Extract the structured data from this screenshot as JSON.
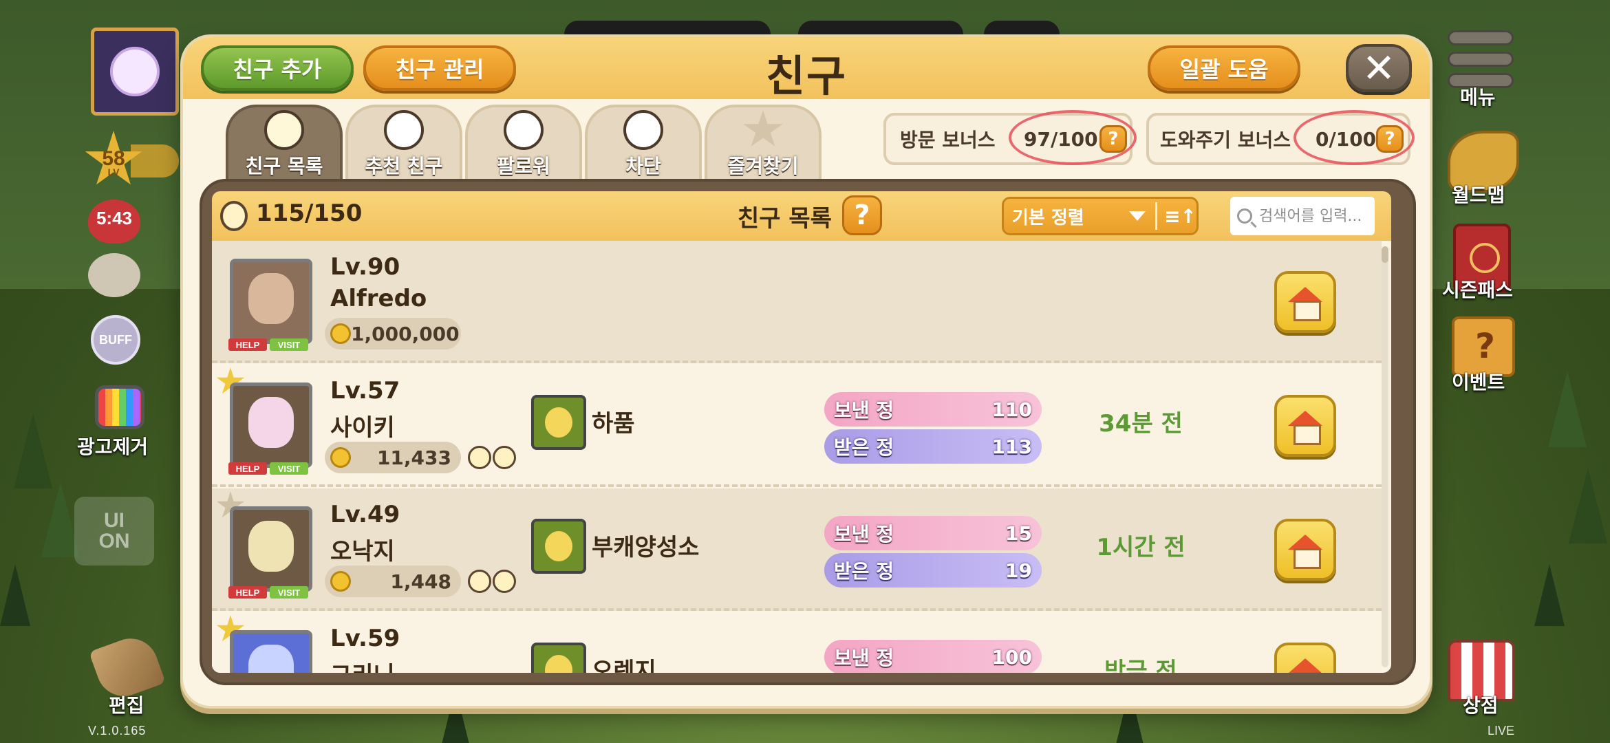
{
  "colors": {
    "panel_bg": "#fbf4e2",
    "header_gold": "#f2c15c",
    "green_button": "#5e9a2b",
    "orange_button": "#e58f1d",
    "last_seen_green": "#5c9a36",
    "sent_pink": "#f4a6c4",
    "received_purple": "#a99ce6"
  },
  "hud_left": {
    "level": "58",
    "level_unit": "LV",
    "timer": "5:43",
    "buff_label": "BUFF",
    "ad_remove_label": "광고제거",
    "ui_toggle_label": "UI\nON",
    "edit_label": "편집",
    "version": "V.1.0.165"
  },
  "hud_right": {
    "menu_label": "메뉴",
    "worldmap_label": "월드맵",
    "seasonpass_label": "시즌패스",
    "event_label": "이벤트",
    "shop_label": "상점",
    "live_label": "LIVE"
  },
  "panel": {
    "title": "친구",
    "add_friend": "친구 추가",
    "manage_friend": "친구 관리",
    "bulk_help": "일괄 도움",
    "close_icon": "✕"
  },
  "tabs": [
    {
      "label": "친구 목록",
      "icon": "friend-face-icon",
      "active": true
    },
    {
      "label": "추천 친구",
      "icon": "recommend-face-icon",
      "active": false
    },
    {
      "label": "팔로워",
      "icon": "follower-face-icon",
      "active": false
    },
    {
      "label": "차단",
      "icon": "block-face-icon",
      "active": false
    },
    {
      "label": "즐겨찾기",
      "icon": "star-icon",
      "active": false
    }
  ],
  "bonuses": {
    "visit": {
      "label": "방문 보너스",
      "value": "97/100",
      "help": "?"
    },
    "help": {
      "label": "도와주기 보너스",
      "value": "0/100",
      "help": "?"
    }
  },
  "list": {
    "count": "115/150",
    "title": "친구 목록",
    "help": "?",
    "sort_label": "기본 정렬",
    "sort_toggle": "≡↑",
    "search_placeholder": "검색어를 입력..."
  },
  "tags": {
    "help": "HELP",
    "visit": "VISIT"
  },
  "friends": [
    {
      "level": "Lv.90",
      "name": "Alfredo",
      "coins": "1,000,000",
      "favorite": false,
      "mutual": false,
      "village": "",
      "sent_label": "",
      "sent": "",
      "received_label": "",
      "received": "",
      "last_seen": ""
    },
    {
      "level": "Lv.57",
      "name": "사이키",
      "coins": "11,433",
      "favorite": true,
      "mutual": true,
      "village": "하품",
      "sent_label": "보낸 정",
      "sent": "110",
      "received_label": "받은 정",
      "received": "113",
      "last_seen": "34분 전"
    },
    {
      "level": "Lv.49",
      "name": "오낙지",
      "coins": "1,448",
      "favorite": false,
      "mutual": true,
      "village": "부캐양성소",
      "sent_label": "보낸 정",
      "sent": "15",
      "received_label": "받은 정",
      "received": "19",
      "last_seen": "1시간 전"
    },
    {
      "level": "Lv.59",
      "name": "그리니",
      "coins": "",
      "favorite": true,
      "mutual": false,
      "village": "오렌지",
      "sent_label": "보낸 정",
      "sent": "100",
      "received_label": "",
      "received": "",
      "last_seen": "방금 전"
    }
  ]
}
